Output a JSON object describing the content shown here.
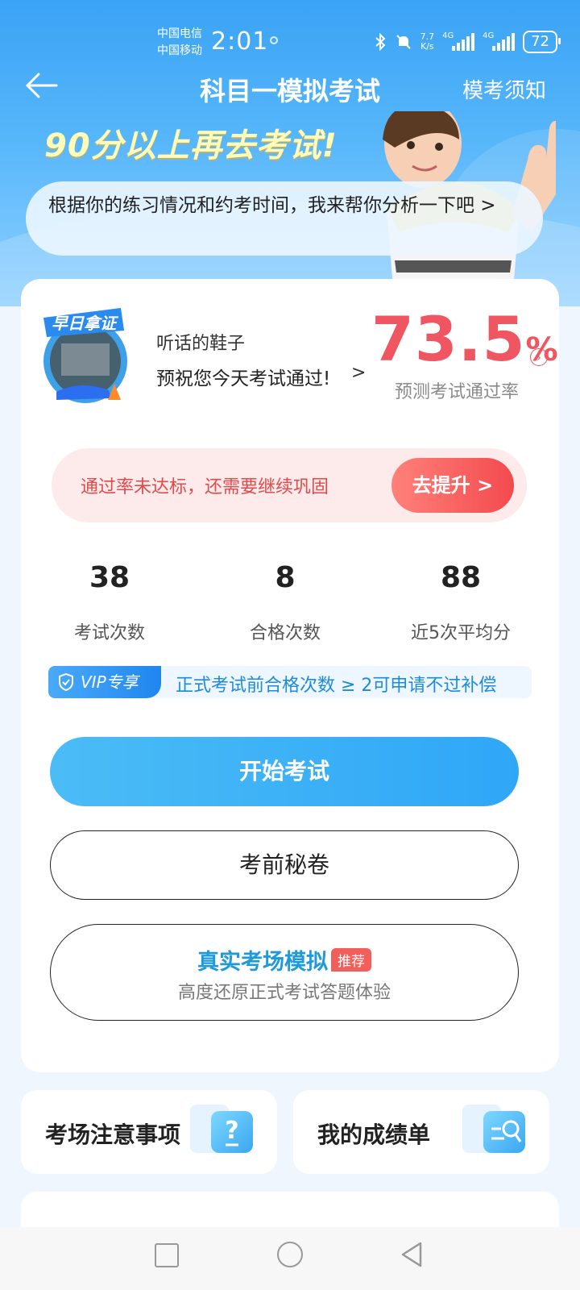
{
  "status_bar": {
    "carrier1": "中国电信",
    "carrier2": "中国移动",
    "time": "2:01",
    "net_speed_value": "7.7",
    "net_speed_unit": "K/s",
    "sig1": "4G",
    "sig2": "4G",
    "battery": "72"
  },
  "nav": {
    "title": "科目一模拟考试",
    "right_link": "模考须知"
  },
  "hero": {
    "slogan": "90分以上再去考试!",
    "bubble": "根据你的练习情况和约考时间，我来帮你分析一下吧 >"
  },
  "profile": {
    "badge_text": "早日拿证",
    "user_name": "听话的鞋子",
    "greeting": "预祝您今天考试通过!",
    "greeting_arrow": ">"
  },
  "pass_rate": {
    "value": "73.5",
    "unit": "%",
    "label": "预测考试通过率"
  },
  "warning": {
    "text": "通过率未达标，还需要继续巩固",
    "button": "去提升 >"
  },
  "stats": [
    {
      "value": "38",
      "label": "考试次数"
    },
    {
      "value": "8",
      "label": "合格次数"
    },
    {
      "value": "88",
      "label": "近5次平均分"
    }
  ],
  "vip": {
    "tag": "VIP专享",
    "text": "正式考试前合格次数 ≥ 2可申请不过补偿"
  },
  "actions": {
    "start": "开始考试",
    "secret": "考前秘卷",
    "real_title": "真实考场模拟",
    "real_badge": "推荐",
    "real_sub": "高度还原正式考试答题体验"
  },
  "bottom_cards": {
    "notice": "考场注意事项",
    "scores": "我的成绩单"
  },
  "colors": {
    "accent_blue": "#2fa7f7",
    "danger_red": "#f05562",
    "hero_bg": "#3aa3f5"
  }
}
